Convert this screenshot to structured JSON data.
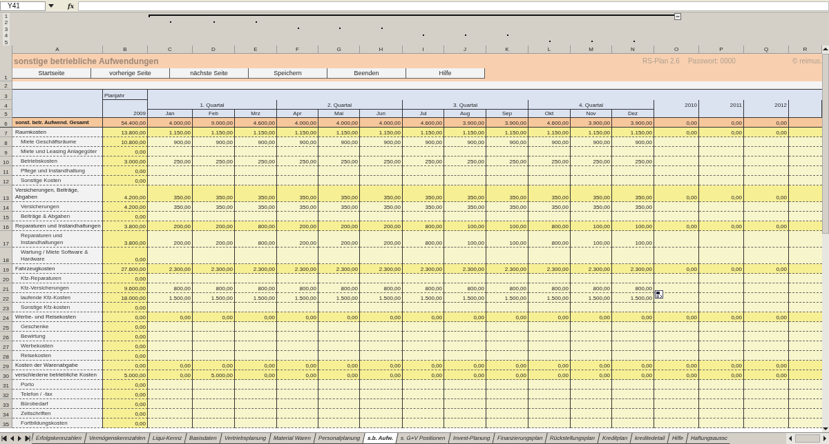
{
  "name_box": "Y41",
  "formula_label": "fx",
  "outline_levels": [
    "1",
    "2",
    "3",
    "4",
    "5"
  ],
  "column_letters": [
    "A",
    "B",
    "C",
    "D",
    "E",
    "F",
    "G",
    "H",
    "I",
    "J",
    "K",
    "L",
    "M",
    "N",
    "O",
    "P",
    "Q",
    "R"
  ],
  "title": "sonstige betriebliche Aufwendungen",
  "version": "RS-Plan 2.6",
  "password": "Passwort: 0000",
  "copyright": "© reimus.",
  "title_row_number": "1",
  "buttons": [
    "Startseite",
    "vorherige Seite",
    "nächste Seite",
    "Speichern",
    "Beenden",
    "Hilfe"
  ],
  "blank_row_number": "2",
  "header": {
    "row_numbers": [
      "3",
      "4",
      "5"
    ],
    "plan_label": "Planjahr",
    "year": "2009",
    "quarters": [
      {
        "label": "1. Quartal",
        "months": [
          "Jan",
          "Feb",
          "Mrz"
        ]
      },
      {
        "label": "2. Quartal",
        "months": [
          "Apr",
          "Mai",
          "Jun"
        ]
      },
      {
        "label": "3. Quartal",
        "months": [
          "Jul",
          "Aug",
          "Sep"
        ]
      },
      {
        "label": "4. Quartal",
        "months": [
          "Okt",
          "Nov",
          "Dez"
        ]
      }
    ],
    "later_years": [
      "2010",
      "2011",
      "2012"
    ]
  },
  "rows": [
    {
      "number": "6",
      "label": "sonst. betr. Aufwend. Gesamt",
      "kind": "total",
      "values": [
        "54.400,00",
        "4.000,00",
        "9.000,00",
        "4.600,00",
        "4.000,00",
        "4.000,00",
        "4.000,00",
        "4.600,00",
        "3.900,00",
        "3.900,00",
        "4.600,00",
        "3.900,00",
        "3.900,00",
        "0,00",
        "0,00",
        "0,00"
      ]
    },
    {
      "number": "7",
      "label": "Raumkosten",
      "kind": "group",
      "values": [
        "13.800,00",
        "1.150,00",
        "1.150,00",
        "1.150,00",
        "1.150,00",
        "1.150,00",
        "1.150,00",
        "1.150,00",
        "1.150,00",
        "1.150,00",
        "1.150,00",
        "1.150,00",
        "1.150,00",
        "0,00",
        "0,00",
        "0,00"
      ],
      "children": [
        {
          "number": "8",
          "label": "Miete Geschäftsräume",
          "kind": "item",
          "values": [
            "10.800,00",
            "900,00",
            "900,00",
            "900,00",
            "900,00",
            "900,00",
            "900,00",
            "900,00",
            "900,00",
            "900,00",
            "900,00",
            "900,00",
            "900,00"
          ]
        },
        {
          "number": "9",
          "label": "Miete und Leasing Anlagegüter",
          "kind": "item",
          "values": [
            "0,00"
          ]
        },
        {
          "number": "10",
          "label": "Betriebskosten",
          "kind": "item",
          "values": [
            "3.000,00",
            "250,00",
            "250,00",
            "250,00",
            "250,00",
            "250,00",
            "250,00",
            "250,00",
            "250,00",
            "250,00",
            "250,00",
            "250,00",
            "250,00"
          ]
        },
        {
          "number": "11",
          "label": "Pflege und Instandhaltung",
          "kind": "item",
          "values": [
            "0,00"
          ]
        },
        {
          "number": "12",
          "label": "Sonstige Kosten",
          "kind": "item",
          "values": [
            "0,00"
          ]
        }
      ]
    },
    {
      "number": "13",
      "label": "Versicherungen, Beiträge, Abgaben",
      "kind": "group",
      "values": [
        "4.200,00",
        "350,00",
        "350,00",
        "350,00",
        "350,00",
        "350,00",
        "350,00",
        "350,00",
        "350,00",
        "350,00",
        "350,00",
        "350,00",
        "350,00",
        "0,00",
        "0,00",
        "0,00"
      ],
      "children": [
        {
          "number": "14",
          "label": "Versicherungen",
          "kind": "item",
          "values": [
            "4.200,00",
            "350,00",
            "350,00",
            "350,00",
            "350,00",
            "350,00",
            "350,00",
            "350,00",
            "350,00",
            "350,00",
            "350,00",
            "350,00",
            "350,00"
          ]
        },
        {
          "number": "15",
          "label": "Beiträge & Abgaben",
          "kind": "item",
          "values": [
            "0,00"
          ]
        }
      ]
    },
    {
      "number": "16",
      "label": "Reparaturen und Instandhaltungen",
      "kind": "group",
      "values": [
        "3.800,00",
        "200,00",
        "200,00",
        "800,00",
        "200,00",
        "200,00",
        "200,00",
        "800,00",
        "100,00",
        "100,00",
        "800,00",
        "100,00",
        "100,00",
        "0,00",
        "0,00",
        "0,00"
      ],
      "children": [
        {
          "number": "17",
          "label": "Reparaturen und Instandhaltungen",
          "kind": "item",
          "values": [
            "3.800,00",
            "200,00",
            "200,00",
            "800,00",
            "200,00",
            "200,00",
            "200,00",
            "800,00",
            "100,00",
            "100,00",
            "800,00",
            "100,00",
            "100,00"
          ]
        },
        {
          "number": "18",
          "label": "Wartung / Miete Software & Hardware",
          "kind": "item",
          "values": [
            "0,00"
          ]
        }
      ]
    },
    {
      "number": "19",
      "label": "Fahrzeugkosten",
      "kind": "group",
      "values": [
        "27.600,00",
        "2.300,00",
        "2.300,00",
        "2.300,00",
        "2.300,00",
        "2.300,00",
        "2.300,00",
        "2.300,00",
        "2.300,00",
        "2.300,00",
        "2.300,00",
        "2.300,00",
        "2.300,00",
        "0,00",
        "0,00",
        "0,00"
      ],
      "children": [
        {
          "number": "20",
          "label": "Kfz-Reparaturen",
          "kind": "item",
          "values": [
            "0,00"
          ]
        },
        {
          "number": "21",
          "label": "Kfz-Versicherungen",
          "kind": "item",
          "values": [
            "9.600,00",
            "800,00",
            "800,00",
            "800,00",
            "800,00",
            "800,00",
            "800,00",
            "800,00",
            "800,00",
            "800,00",
            "800,00",
            "800,00",
            "800,00"
          ]
        },
        {
          "number": "22",
          "label": "laufende Kfz-Kosten",
          "kind": "item",
          "values": [
            "18.000,00",
            "1.500,00",
            "1.500,00",
            "1.500,00",
            "1.500,00",
            "1.500,00",
            "1.500,00",
            "1.500,00",
            "1.500,00",
            "1.500,00",
            "1.500,00",
            "1.500,00",
            "1.500,00"
          ]
        },
        {
          "number": "23",
          "label": "Sonstige Kfz-kosten",
          "kind": "item",
          "values": [
            "0,00"
          ]
        }
      ]
    },
    {
      "number": "24",
      "label": "Werbe- und Reisekosten",
      "kind": "group",
      "values": [
        "0,00",
        "0,00",
        "0,00",
        "0,00",
        "0,00",
        "0,00",
        "0,00",
        "0,00",
        "0,00",
        "0,00",
        "0,00",
        "0,00",
        "0,00",
        "0,00",
        "0,00",
        "0,00"
      ],
      "children": [
        {
          "number": "25",
          "label": "Geschenke",
          "kind": "item",
          "values": [
            "0,00"
          ]
        },
        {
          "number": "26",
          "label": "Bewirtung",
          "kind": "item",
          "values": [
            "0,00"
          ]
        },
        {
          "number": "27",
          "label": "Werbekosten",
          "kind": "item",
          "values": [
            "0,00"
          ]
        },
        {
          "number": "28",
          "label": "Reisekosten",
          "kind": "item",
          "values": [
            "0,00"
          ]
        }
      ]
    },
    {
      "number": "29",
      "label": "Kosten der Warenabgabe",
      "kind": "group",
      "values": [
        "0,00",
        "0,00",
        "0,00",
        "0,00",
        "0,00",
        "0,00",
        "0,00",
        "0,00",
        "0,00",
        "0,00",
        "0,00",
        "0,00",
        "0,00",
        "0,00",
        "0,00",
        "0,00"
      ]
    },
    {
      "number": "30",
      "label": "verschiedene betriebliche Kosten",
      "kind": "group",
      "values": [
        "5.000,00",
        "0,00",
        "5.000,00",
        "0,00",
        "0,00",
        "0,00",
        "0,00",
        "0,00",
        "0,00",
        "0,00",
        "0,00",
        "0,00",
        "0,00",
        "0,00",
        "0,00",
        "0,00"
      ],
      "children": [
        {
          "number": "31",
          "label": "Porto",
          "kind": "item",
          "values": [
            "0,00"
          ]
        },
        {
          "number": "32",
          "label": "Telefon / -fax",
          "kind": "item",
          "values": [
            "0,00"
          ]
        },
        {
          "number": "33",
          "label": "Bürobedarf",
          "kind": "item",
          "values": [
            "0,00"
          ]
        },
        {
          "number": "34",
          "label": "Zeitschriften",
          "kind": "item",
          "values": [
            "0,00"
          ]
        },
        {
          "number": "35",
          "label": "Fortbildungskosten",
          "kind": "item",
          "values": [
            "0,00"
          ]
        }
      ]
    }
  ],
  "sheet_tabs": [
    {
      "label": "Erfolgskennzahlen",
      "selected": false
    },
    {
      "label": "Vermögenskennzahlen",
      "selected": false
    },
    {
      "label": "Liqui-Kennz",
      "selected": false
    },
    {
      "label": "Basisdaten",
      "selected": false
    },
    {
      "label": "Vertriebsplanung",
      "selected": false
    },
    {
      "label": "Material Waren",
      "selected": false
    },
    {
      "label": "Personalplanung",
      "selected": false
    },
    {
      "label": "s.b. Aufw.",
      "selected": true
    },
    {
      "label": "s. G+V Positionen",
      "selected": false
    },
    {
      "label": "Invest-Planung",
      "selected": false
    },
    {
      "label": "Finanzierungsplan",
      "selected": false
    },
    {
      "label": "Rückstellungsplan",
      "selected": false
    },
    {
      "label": "Kreditplan",
      "selected": false
    },
    {
      "label": "kreditedetail",
      "selected": false
    },
    {
      "label": "Hilfe",
      "selected": false
    },
    {
      "label": "Haftungsaussc",
      "selected": false
    }
  ]
}
